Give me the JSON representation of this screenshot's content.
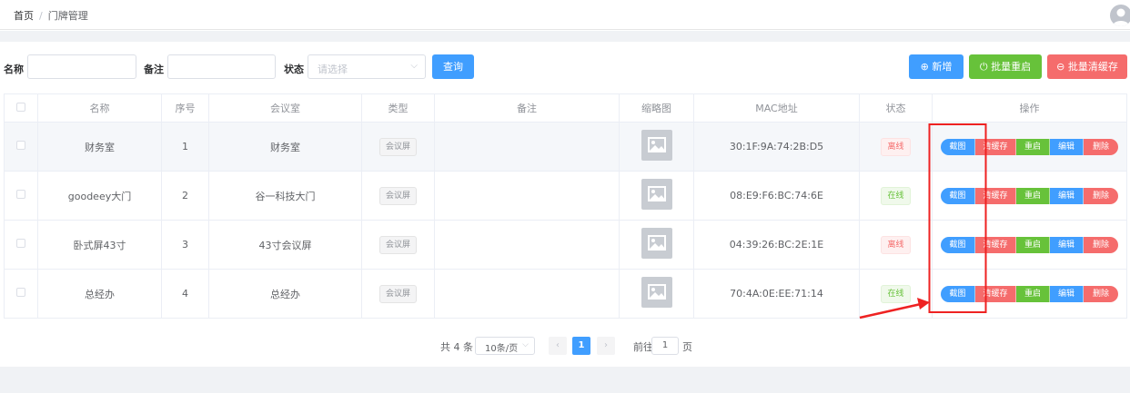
{
  "breadcrumb": {
    "home": "首页",
    "separator": "/",
    "current": "门牌管理"
  },
  "filters": {
    "name_label": "名称",
    "name_value": "",
    "remark_label": "备注",
    "remark_value": "",
    "status_label": "状态",
    "status_placeholder": "请选择",
    "query_label": "查询"
  },
  "toolbar": {
    "add_label": "新增",
    "batch_restart_label": "批量重启",
    "batch_clear_label": "批量清缓存"
  },
  "table": {
    "headers": [
      "名称",
      "序号",
      "会议室",
      "类型",
      "备注",
      "缩略图",
      "MAC地址",
      "状态",
      "操作"
    ],
    "rows": [
      {
        "name": "财务室",
        "index": "1",
        "room": "财务室",
        "type": "会议屏",
        "remark": "",
        "mac": "30:1F:9A:74:2B:D5",
        "status": "离线",
        "status_kind": "offline"
      },
      {
        "name": "goodeey大门",
        "index": "2",
        "room": "谷一科技大门",
        "type": "会议屏",
        "remark": "",
        "mac": "08:E9:F6:BC:74:6E",
        "status": "在线",
        "status_kind": "online"
      },
      {
        "name": "卧式屏43寸",
        "index": "3",
        "room": "43寸会议屏",
        "type": "会议屏",
        "remark": "",
        "mac": "04:39:26:BC:2E:1E",
        "status": "离线",
        "status_kind": "offline"
      },
      {
        "name": "总经办",
        "index": "4",
        "room": "总经办",
        "type": "会议屏",
        "remark": "",
        "mac": "70:4A:0E:EE:71:14",
        "status": "在线",
        "status_kind": "online"
      }
    ],
    "row_actions": [
      "截图",
      "清缓存",
      "重启",
      "编辑",
      "删除"
    ]
  },
  "pagination": {
    "total_text": "共 4 条",
    "page_size": "10条/页",
    "current_page": "1",
    "goto_label": "前往",
    "goto_value": "1",
    "goto_unit": "页"
  },
  "colors": {
    "primary": "#409eff",
    "success": "#67c23a",
    "danger": "#f56c6c",
    "annotation": "#ee2222"
  }
}
